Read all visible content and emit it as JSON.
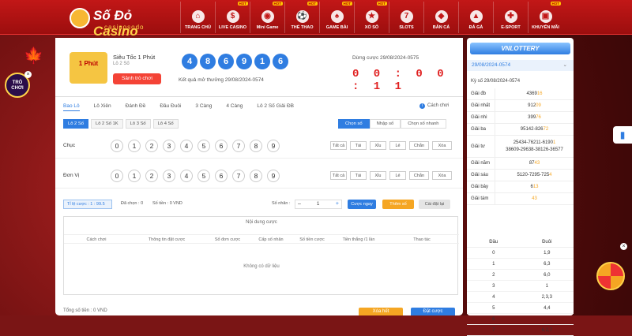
{
  "brand": {
    "name1": "Số Đỏ",
    "name2": "Casino",
    "sub": "casinosodo"
  },
  "nav": [
    {
      "label": "TRANG CHỦ",
      "icon": "home-icon",
      "hot": ""
    },
    {
      "label": "LIVE CASINO",
      "icon": "chip-icon",
      "hot": "HOT"
    },
    {
      "label": "Mini Game",
      "icon": "gamepad-icon",
      "hot": "HOT"
    },
    {
      "label": "THỂ THAO",
      "icon": "soccer-icon",
      "hot": "HOT"
    },
    {
      "label": "GAME BÀI",
      "icon": "cards-icon",
      "hot": "HOT"
    },
    {
      "label": "XỔ SỐ",
      "icon": "lottery-icon",
      "hot": "HOT"
    },
    {
      "label": "SLOTS",
      "icon": "slot-icon",
      "hot": ""
    },
    {
      "label": "BẮN CÁ",
      "icon": "fish-icon",
      "hot": ""
    },
    {
      "label": "ĐÁ GÀ",
      "icon": "rooster-icon",
      "hot": ""
    },
    {
      "label": "E-SPORT",
      "icon": "controller-icon",
      "hot": ""
    },
    {
      "label": "KHUYẾN MÃI",
      "icon": "gift-icon",
      "hot": "HOT"
    }
  ],
  "game": {
    "title": "Siêu Tốc 1 Phút",
    "sub": "Lô 2 Số",
    "badge": "1 Phút",
    "cta": "Sảnh trò chơi",
    "balls": [
      "4",
      "8",
      "6",
      "9",
      "1",
      "6"
    ],
    "result": "Kết quả mở thưởng 29/08/2024-0574",
    "count_label": "Dừng cược 29/08/2024-0575",
    "timer": "0 0 : 0 0 : 1 1"
  },
  "tabs": [
    "Bao Lô",
    "Lô Xiên",
    "Đánh Đề",
    "Đầu Đuôi",
    "3 Càng",
    "4 Càng",
    "Lô 2 Số Giải ĐB"
  ],
  "help": "Cách chơi",
  "subtabs": [
    "Lô 2 Số",
    "Lô 2 Số 1K",
    "Lô 3 Số",
    "Lô 4 Số"
  ],
  "modes": [
    "Chọn số",
    "Nhập số",
    "Chọn số nhanh"
  ],
  "rows": [
    {
      "label": "Chục"
    },
    {
      "label": "Đơn Vị"
    }
  ],
  "digits": [
    "0",
    "1",
    "2",
    "3",
    "4",
    "5",
    "6",
    "7",
    "8",
    "9"
  ],
  "quick": [
    "Tất cả",
    "Tài",
    "Xỉu",
    "Lẻ",
    "Chẵn",
    "Xóa"
  ],
  "bet": {
    "rate": "Tỉ lệ cược : 1 : 99.5",
    "selected": "Đã chọn : 0",
    "money": "Số tiền : 0 VND",
    "mult": "Số nhân :",
    "value": "1",
    "b1": "Cược ngay",
    "b2": "Thêm số",
    "b3": "Cài đặt lại"
  },
  "table": {
    "title": "Nội dung cược",
    "headers": [
      "Cách chơi",
      "Thông tin đặt cược",
      "Số đơn cược",
      "Cấp số nhân",
      "Số tiền cược",
      "Tiền thắng /1 lần",
      "Thao tác"
    ],
    "empty": "Không có dữ liệu"
  },
  "footer": {
    "total": "Tổng số tiền : 0 VND",
    "b1": "Xóa hết",
    "b2": "Đặt cược"
  },
  "side": {
    "logo": "VNLOTTERY",
    "date": "29/08/2024-0574",
    "kyso": "Kỳ số 29/08/2024-0574",
    "prizes": [
      {
        "k": "Giải đb",
        "v": "4369",
        "h": "16"
      },
      {
        "k": "Giải nhất",
        "v": "912",
        "h": "09"
      },
      {
        "k": "Giải nhì",
        "v": "399",
        "h": "76"
      },
      {
        "k": "Giải ba",
        "v": "95142-826",
        "h": "72"
      },
      {
        "k": "Giải tư",
        "v": "25434-76211-6190",
        "h": "1",
        "v2": "38609-29638-38126-36577"
      },
      {
        "k": "Giải năm",
        "v": "87",
        "h": "43"
      },
      {
        "k": "Giải sáu",
        "v": "5120-7295-725",
        "h": "4"
      },
      {
        "k": "Giải bảy",
        "v": "6",
        "h": "13"
      },
      {
        "k": "Giải tám",
        "v": "",
        "h": "43"
      }
    ],
    "dd_head": [
      "Đầu",
      "Đuôi"
    ],
    "dd": [
      [
        "0",
        "1,9"
      ],
      [
        "1",
        "6,3"
      ],
      [
        "2",
        "6,0"
      ],
      [
        "3",
        "1"
      ],
      [
        "4",
        "2,3,3"
      ],
      [
        "5",
        "4,4"
      ],
      [
        "6",
        ""
      ],
      [
        "7",
        "6,2,7"
      ]
    ]
  },
  "float": {
    "label": "TRÒ CHƠI"
  }
}
